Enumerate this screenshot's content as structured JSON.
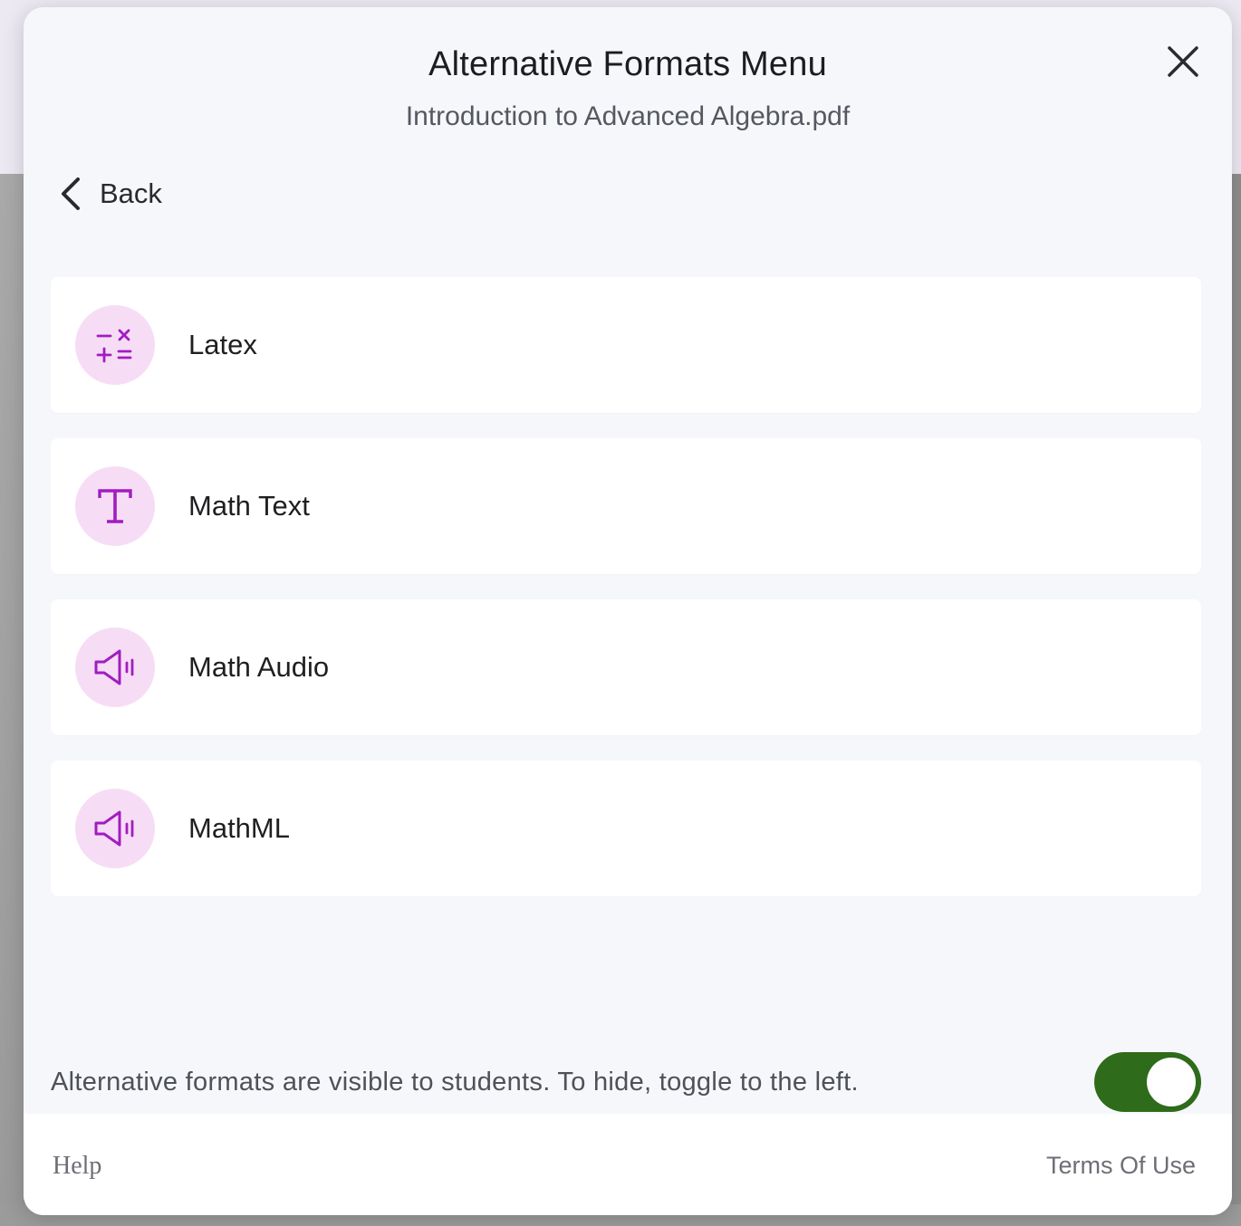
{
  "modal": {
    "title": "Alternative Formats Menu",
    "subtitle": "Introduction to Advanced Algebra.pdf",
    "close_icon": "close-icon",
    "back_label": "Back"
  },
  "options": [
    {
      "label": "Latex",
      "icon": "math-operators-icon"
    },
    {
      "label": "Math Text",
      "icon": "text-t-icon"
    },
    {
      "label": "Math Audio",
      "icon": "speaker-icon"
    },
    {
      "label": "MathML",
      "icon": "speaker-icon"
    }
  ],
  "visibility": {
    "text": "Alternative formats are visible to students. To hide, toggle to the left.",
    "toggle_on": true
  },
  "footer": {
    "help": "Help",
    "terms": "Terms Of Use"
  },
  "colors": {
    "accent": "#a21cc2",
    "icon_bg": "#f6ddf5",
    "toggle_on": "#2e6b1a",
    "modal_bg": "#f6f7fb"
  }
}
